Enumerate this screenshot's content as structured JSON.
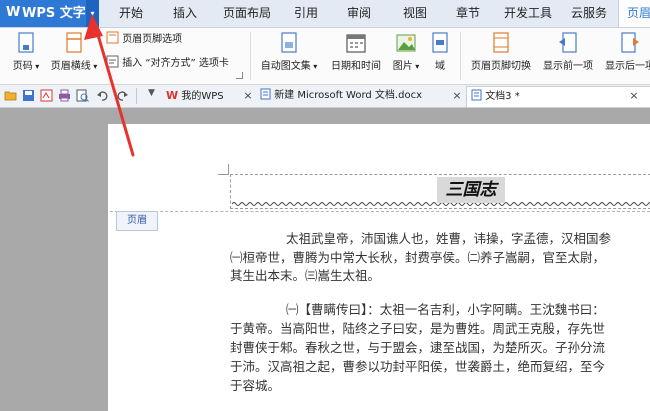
{
  "app": {
    "logo_label": "W",
    "name": "WPS 文字",
    "dropdown_glyph": "▾"
  },
  "menu_tabs": [
    "开始",
    "插入",
    "页面布局",
    "引用",
    "审阅",
    "视图",
    "章节",
    "开发工具",
    "云服务",
    "页眉"
  ],
  "ribbon": {
    "page_number": "页码",
    "header_line": "页眉横线",
    "header_footer_options": "页眉页脚选项",
    "insert_align_tab": "插入 “对齐方式” 选项卡",
    "auto_doc_info": "自动图文集",
    "date_time": "日期和时间",
    "picture": "图片",
    "field": "域",
    "switch_header_footer": "页眉页脚切换",
    "show_previous": "显示前一项",
    "show_next": "显示后一项"
  },
  "doc_tabs": [
    {
      "label": "我的WPS",
      "icon": "wps-logo-icon"
    },
    {
      "label": "新建 Microsoft Word 文档.docx",
      "icon": "word-doc-icon"
    },
    {
      "label": "文档3 *",
      "icon": "word-doc-icon",
      "active": true
    }
  ],
  "close_glyph": "×",
  "document": {
    "header_title": "三国志",
    "header_label": "页眉",
    "paragraphs": [
      "太祖武皇帝，沛国谯人也，姓曹，讳操，字孟德，汉相国参",
      "㈠桓帝世，曹腾为中常大长秋，封费亭侯。㈡养子嵩嗣，官至太尉，",
      "其生出本末。㈢嵩生太祖。",
      "㈠【曹瞒传曰】：太祖一名吉利，小字阿瞒。王沈魏书曰：",
      "于黄帝。当高阳世，陆终之子曰安，是为曹姓。周武王克殷，存先世",
      "封曹侠于邾。春秋之世，与于盟会，逮至战国，为楚所灭。子孙分流",
      "于沛。汉高祖之起，曹参以功封平阳侯，世袭爵土，绝而复绍，至今",
      "于容城。"
    ]
  },
  "colors": {
    "accent": "#2f79d6",
    "arrow": "#e8322d"
  }
}
